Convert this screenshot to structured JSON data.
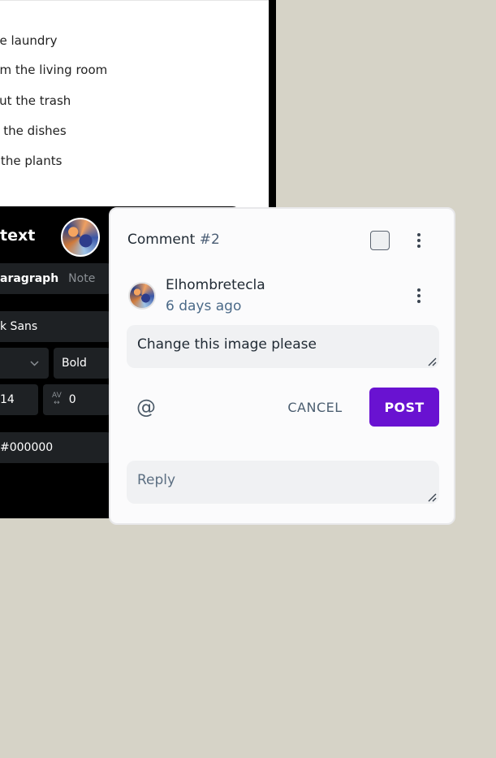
{
  "canvas": {
    "todo_items": [
      "he laundry",
      "um the living room",
      "out the trash",
      "n the dishes",
      "r the plants"
    ],
    "editor": {
      "title": "text",
      "tabs": {
        "active": "aragraph",
        "other": "Note"
      },
      "font_family": "k Sans",
      "font_weight": "Bold",
      "font_size": "14",
      "letter_spacing": "0",
      "color_hex": "#000000"
    }
  },
  "comment": {
    "title_label": "Comment",
    "title_number": "#2",
    "author": "Elhombretecla",
    "timestamp": "6 days ago",
    "body_value": "Change this image please",
    "mention_icon": "@",
    "cancel_label": "CANCEL",
    "post_label": "POST",
    "reply_placeholder": "Reply"
  },
  "colors": {
    "background": "#d6d3c7",
    "accent": "#6912d1",
    "card": "#fbfbfc",
    "muted_text": "#4b6a88"
  }
}
